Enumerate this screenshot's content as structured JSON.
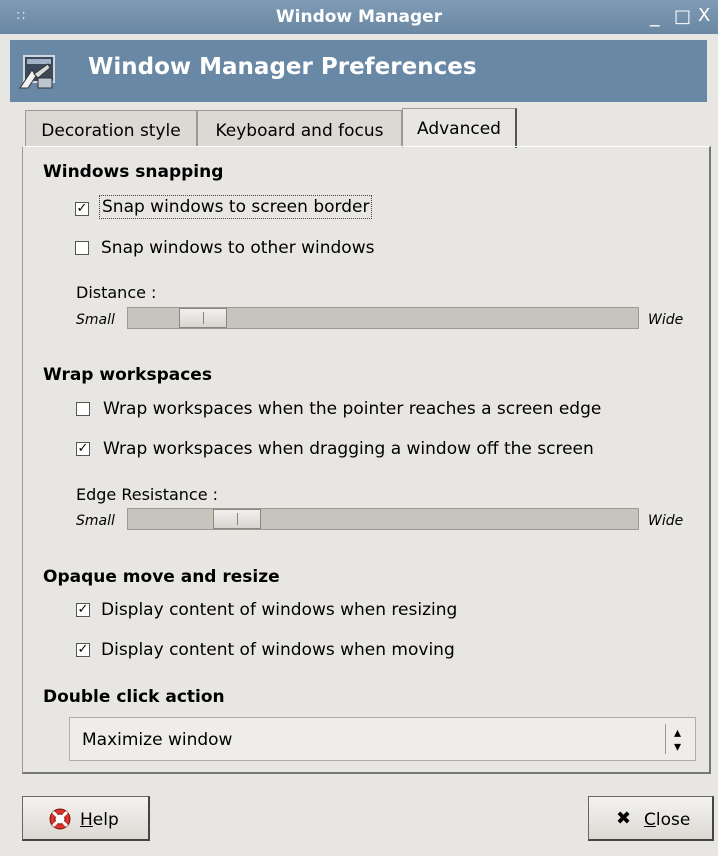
{
  "window": {
    "title": "Window Manager",
    "grip": "::",
    "minimize": "_",
    "maximize": "□",
    "close": "X"
  },
  "header": {
    "title": "Window Manager Preferences",
    "icon": "window-manager-app-icon"
  },
  "tabs": [
    {
      "label": "Decoration style",
      "active": false
    },
    {
      "label": "Keyboard and focus",
      "active": false
    },
    {
      "label": "Advanced",
      "active": true
    }
  ],
  "sections": {
    "snapping": {
      "title": "Windows snapping",
      "options": [
        {
          "label": "Snap windows to screen border",
          "checked": true
        },
        {
          "label": "Snap windows to other windows",
          "checked": false
        }
      ],
      "slider": {
        "label": "Distance :",
        "min_label": "Small",
        "max_label": "Wide",
        "value_fraction": 0.1
      }
    },
    "wrap": {
      "title": "Wrap workspaces",
      "options": [
        {
          "label": "Wrap workspaces when the pointer reaches a screen edge",
          "checked": false
        },
        {
          "label": "Wrap workspaces when dragging a window off the screen",
          "checked": true
        }
      ],
      "slider": {
        "label": "Edge Resistance :",
        "min_label": "Small",
        "max_label": "Wide",
        "value_fraction": 0.17
      }
    },
    "opaque": {
      "title": "Opaque move and resize",
      "options": [
        {
          "label": "Display content of windows when resizing",
          "checked": true
        },
        {
          "label": "Display content of windows when moving",
          "checked": true
        }
      ]
    },
    "double_click": {
      "title": "Double click action",
      "selected": "Maximize window"
    }
  },
  "buttons": {
    "help_underlined": "H",
    "help_rest": "elp",
    "close_underlined": "C",
    "close_rest": "lose",
    "close_glyph": "✖"
  },
  "colors": {
    "titlebar": "#7390ac",
    "header": "#6988a6",
    "background": "#e8e6e2"
  }
}
